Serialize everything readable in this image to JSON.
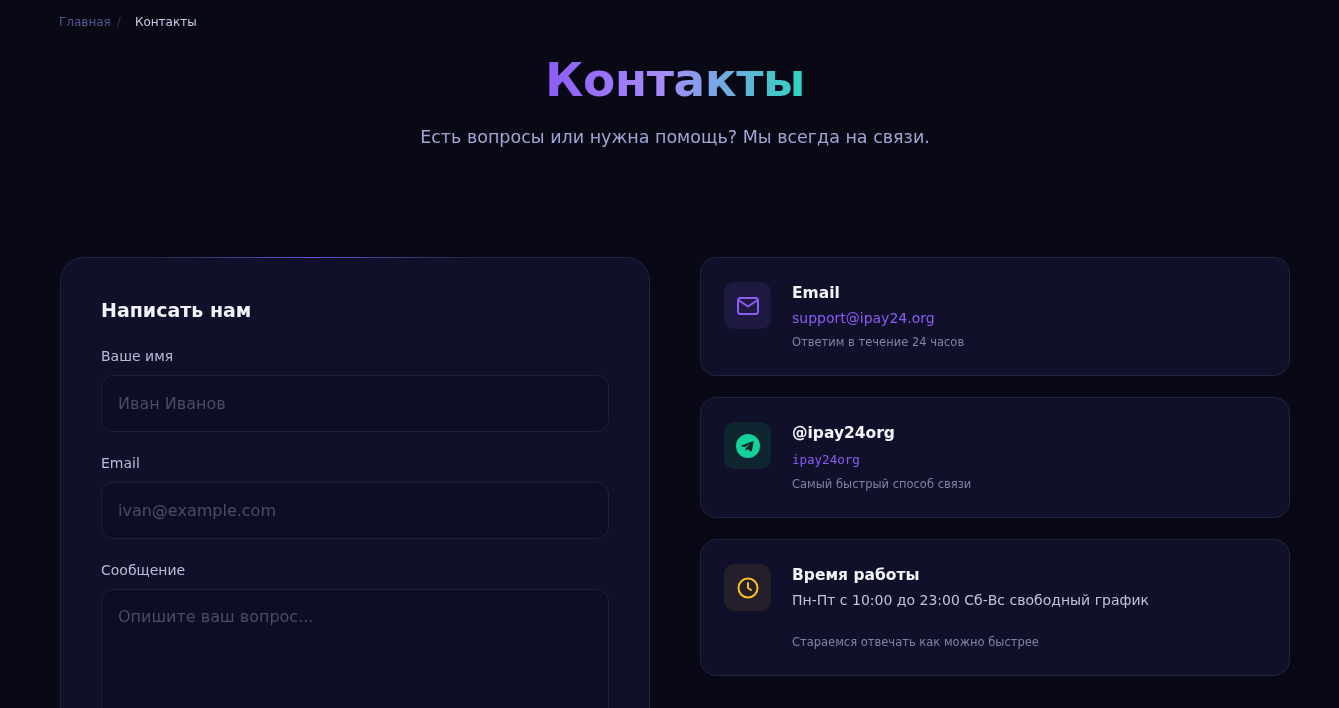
{
  "breadcrumbs": [
    {
      "label": "Главная",
      "current": false
    },
    {
      "label": "Контакты",
      "current": true
    }
  ],
  "breadcrumb_separator": "/",
  "title": "Контакты",
  "subtitle": "Есть вопросы или нужна помощь? Мы всегда на связи.",
  "form": {
    "title": "Написать нам",
    "fields": [
      {
        "kind": "text",
        "label": "Ваше имя",
        "placeholder": "Иван Иванов"
      },
      {
        "kind": "text",
        "label": "Email",
        "placeholder": "ivan@example.com"
      },
      {
        "kind": "textarea",
        "label": "Сообщение",
        "placeholder": "Опишите ваш вопрос..."
      }
    ]
  },
  "contacts": [
    {
      "kind": "email",
      "title": "Email",
      "value": "support@ipay24.org",
      "note": "Ответим в течение 24 часов"
    },
    {
      "kind": "telegram",
      "title": "@ipay24org",
      "value": "ipay24org",
      "note": "Самый быстрый способ связи"
    },
    {
      "kind": "hours",
      "title": "Время работы",
      "value": "Пн-Пт с 10:00 до 23:00 Сб-Вс свободный график",
      "note": "Стараемся отвечать как можно быстрее"
    }
  ]
}
